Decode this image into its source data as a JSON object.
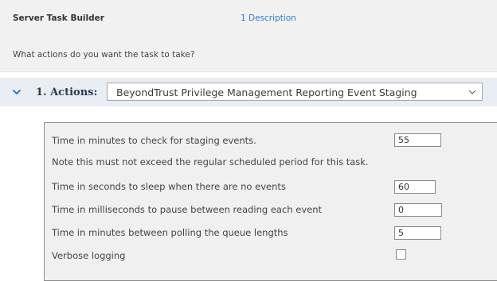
{
  "header": {
    "title": "Server Task Builder",
    "step_link": "1 Description",
    "question": "What actions do you want the task to take?"
  },
  "actions": {
    "label": "1. Actions:",
    "selected_option": "BeyondTrust Privilege Management Reporting Event Staging"
  },
  "settings": [
    {
      "label": "Time in minutes to check for staging events.",
      "value": "55"
    },
    {
      "label": "Note this must not exceed the regular scheduled period for this task."
    },
    {
      "label": "Time in seconds to sleep when there are no events",
      "value": "60"
    },
    {
      "label": "Time in milliseconds to pause between reading each event",
      "value": "0"
    },
    {
      "label": "Time in minutes between polling the queue lengths",
      "value": "5"
    },
    {
      "label": "Verbose logging",
      "checked": false
    }
  ],
  "colors": {
    "link": "#2d7bd0",
    "actions_band": "#e9eef4",
    "panel_background": "#f0f0f0"
  },
  "icons": {
    "expand": "chevron-down-icon",
    "dropdown": "chevron-down-icon"
  }
}
